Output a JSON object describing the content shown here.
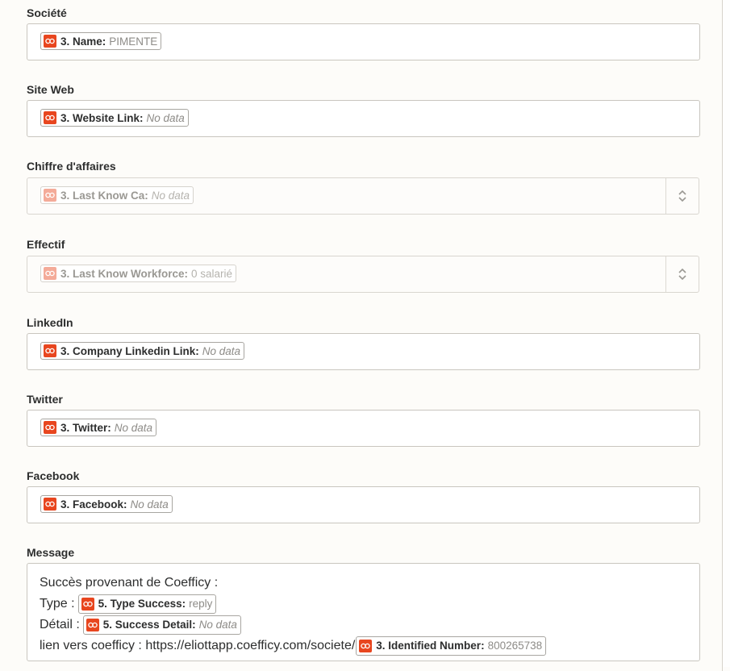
{
  "fields": [
    {
      "label": "Société",
      "pill": {
        "name": "3. Name:",
        "value": "PIMENTE"
      }
    },
    {
      "label": "Site Web",
      "pill": {
        "name": "3. Website Link:",
        "value": "No data"
      }
    },
    {
      "label": "Chiffre d'affaires",
      "pill": {
        "name": "3. Last Know Ca:",
        "value": "No data"
      }
    },
    {
      "label": "Effectif",
      "pill": {
        "name": "3. Last Know Workforce:",
        "value": "0 salarié"
      }
    },
    {
      "label": "LinkedIn",
      "pill": {
        "name": "3. Company Linkedin Link:",
        "value": "No data"
      }
    },
    {
      "label": "Twitter",
      "pill": {
        "name": "3. Twitter:",
        "value": "No data"
      }
    },
    {
      "label": "Facebook",
      "pill": {
        "name": "3. Facebook:",
        "value": "No data"
      }
    }
  ],
  "message": {
    "label": "Message",
    "line1": "Succès provenant de Coefficy :",
    "line2_prefix": "Type :",
    "line2_pill": {
      "name": "5. Type Success:",
      "value": "reply"
    },
    "line3_prefix": "Détail :",
    "line3_pill": {
      "name": "5. Success Detail:",
      "value": "No data"
    },
    "line4_prefix": "lien vers coefficy : https://eliottapp.coefficy.com/societe/",
    "line4_pill": {
      "name": "3. Identified Number:",
      "value": "800265738"
    }
  },
  "colors": {
    "brand": "#e8461f",
    "border": "#c9c6bf",
    "background": "#fdfcfa"
  },
  "icons": {
    "pill_logo": "coefficy-logo-icon",
    "stepper": "chevron-up-down-icon"
  }
}
